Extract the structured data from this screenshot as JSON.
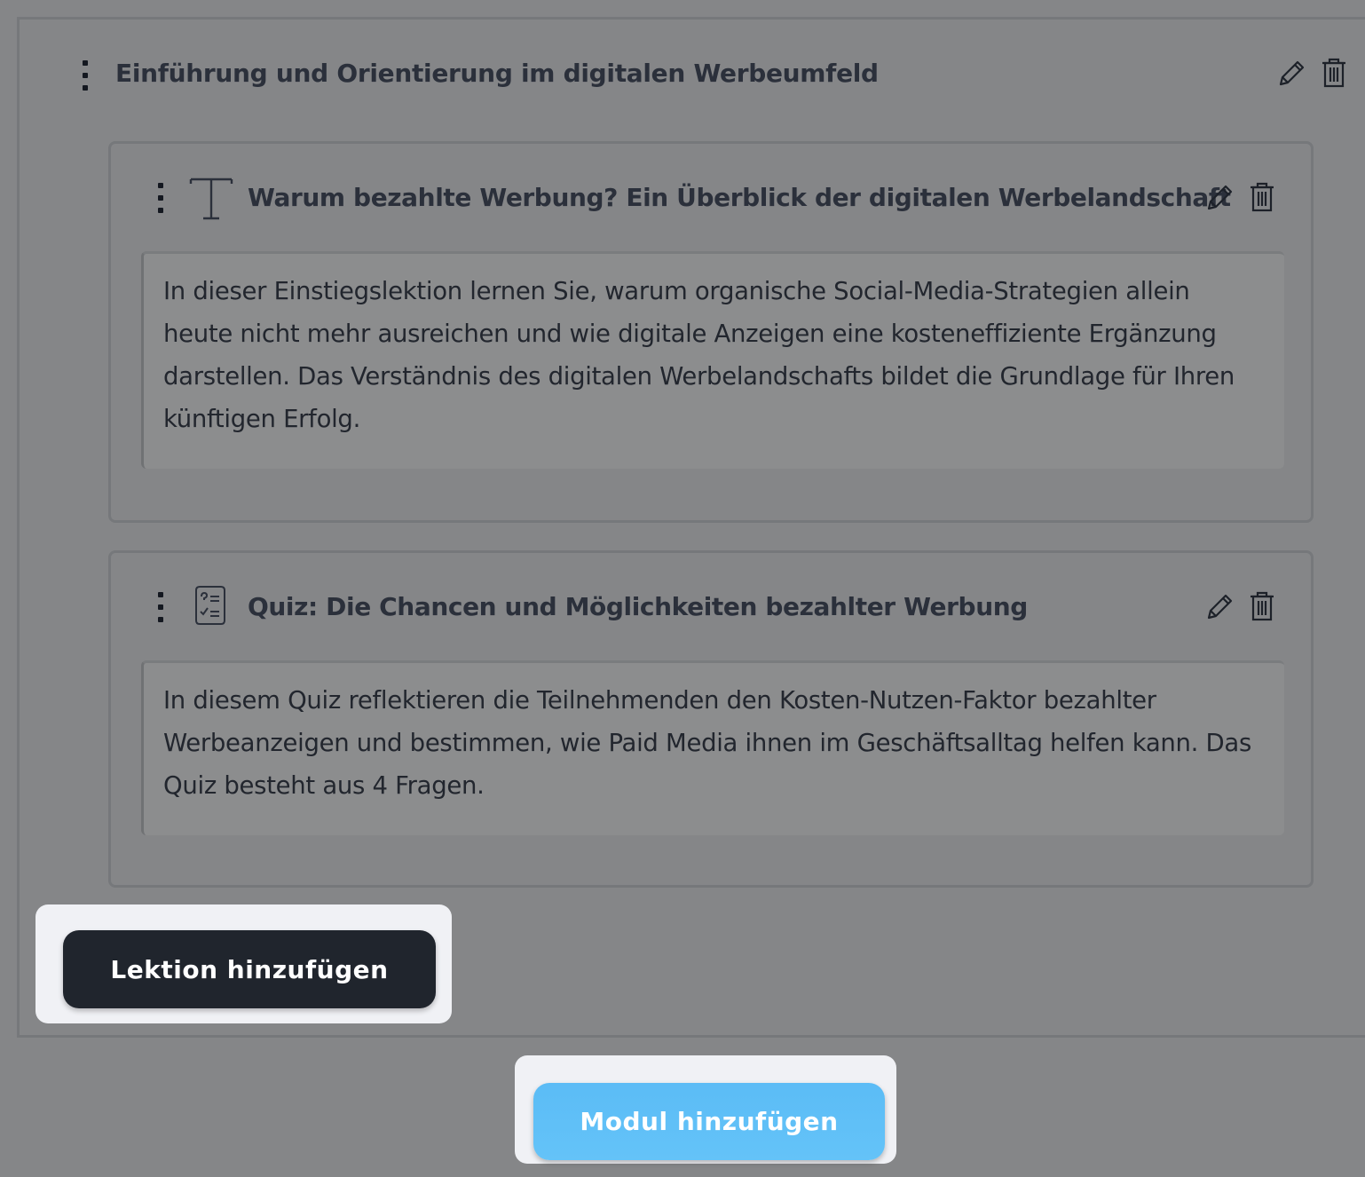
{
  "module": {
    "title": "Einführung und Orientierung im digitalen Werbeumfeld",
    "edit_icon": "pencil-icon",
    "delete_icon": "trash-icon"
  },
  "lessons": [
    {
      "type_icon": "text-type-icon",
      "title": "Warum bezahlte Werbung? Ein Überblick der digitalen Werbelandschaft",
      "description": "In dieser Einstiegslektion lernen Sie, warum organische Social-Media-Strategien allein heute nicht mehr ausreichen und wie digitale Anzeigen eine kosteneffiziente Ergänzung darstellen. Das Verständnis des digitalen Werbelandschafts bildet die Grundlage für Ihren künftigen Erfolg."
    },
    {
      "type_icon": "quiz-icon",
      "title": "Quiz: Die Chancen und Möglichkeiten bezahlter Werbung",
      "description": "In diesem Quiz reflektieren die Teilnehmenden den Kosten-Nutzen-Faktor bezahlter Werbeanzeigen und bestimmen, wie Paid Media ihnen im Geschäftsalltag helfen kann. Das Quiz besteht aus 4 Fragen."
    }
  ],
  "actions": {
    "add_lesson_label": "Lektion hinzufügen",
    "add_module_label": "Modul hinzufügen"
  },
  "colors": {
    "overlay_background": "#858688",
    "dark_button": "#20252d",
    "accent_button": "#5bbcf6"
  }
}
